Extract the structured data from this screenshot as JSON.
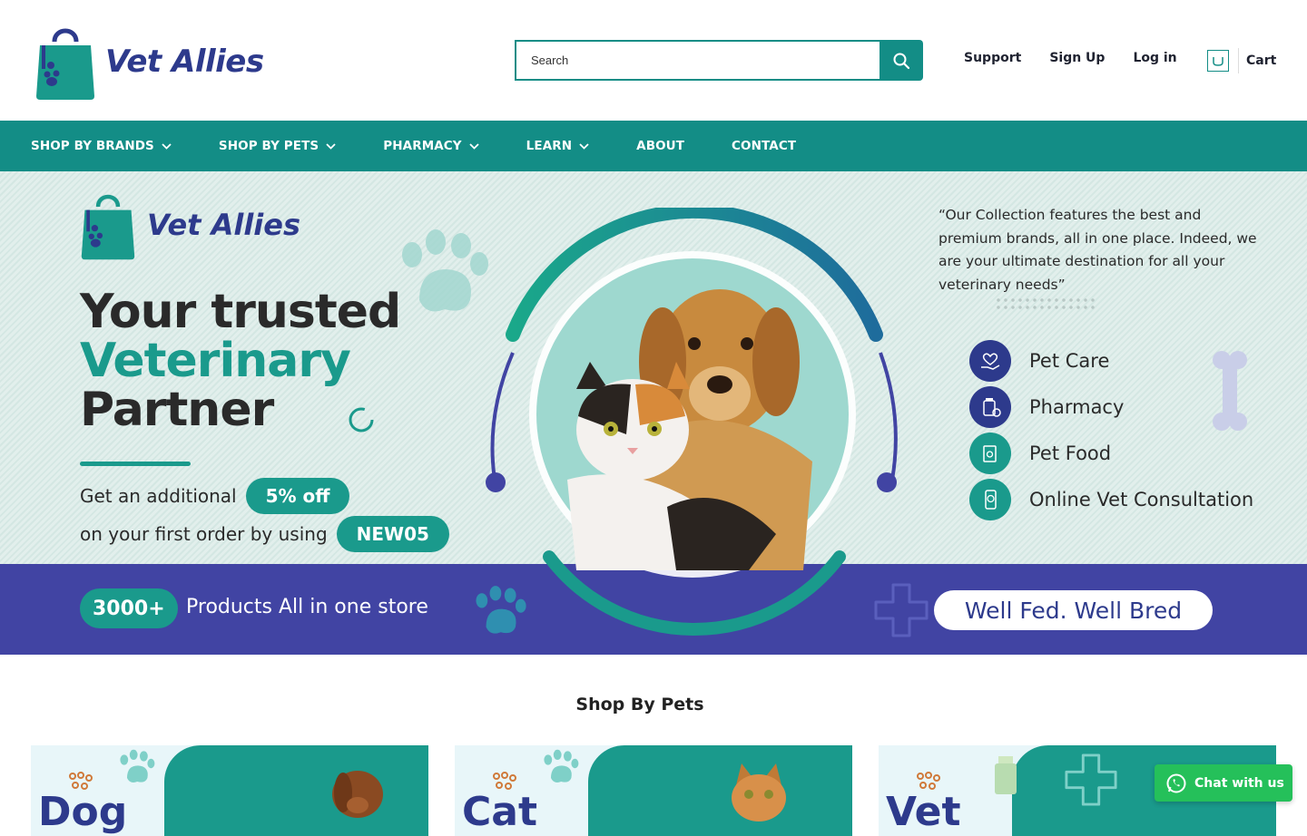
{
  "brand": {
    "name_part1": "Vet",
    "name_part2": "Allies"
  },
  "search": {
    "placeholder": "Search"
  },
  "top_links": {
    "support": "Support",
    "signup": "Sign Up",
    "login": "Log in",
    "cart": "Cart"
  },
  "nav": {
    "items": [
      {
        "label": "SHOP BY BRANDS",
        "dropdown": true
      },
      {
        "label": "SHOP BY PETS",
        "dropdown": true
      },
      {
        "label": "PHARMACY",
        "dropdown": true
      },
      {
        "label": "LEARN",
        "dropdown": true
      },
      {
        "label": "ABOUT",
        "dropdown": false
      },
      {
        "label": "CONTACT",
        "dropdown": false
      }
    ]
  },
  "hero": {
    "headline_line1": "Your trusted",
    "headline_line2": "Veterinary",
    "headline_line3": "Partner",
    "offer_text1": "Get an additional",
    "offer_pill1": "5% off",
    "offer_text2": "on your first order by using",
    "offer_pill2": "NEW05",
    "products_count": "3000+",
    "products_text": "Products All in one store",
    "quote": "“Our Collection features the best and premium brands, all in one place. Indeed, we are your ultimate destination for all your veterinary needs”",
    "services": [
      "Pet Care",
      "Pharmacy",
      "Pet Food",
      "Online Vet Consultation"
    ],
    "tagline": "Well Fed. Well Bred"
  },
  "shop_by_pets": {
    "title": "Shop By Pets",
    "cards": [
      "Dog",
      "Cat",
      "Vet"
    ]
  },
  "chat": {
    "label": "Chat with us"
  },
  "colors": {
    "teal": "#138d86",
    "indigo": "#2d3a8c",
    "band": "#4144a3",
    "whatsapp": "#25c05a"
  }
}
